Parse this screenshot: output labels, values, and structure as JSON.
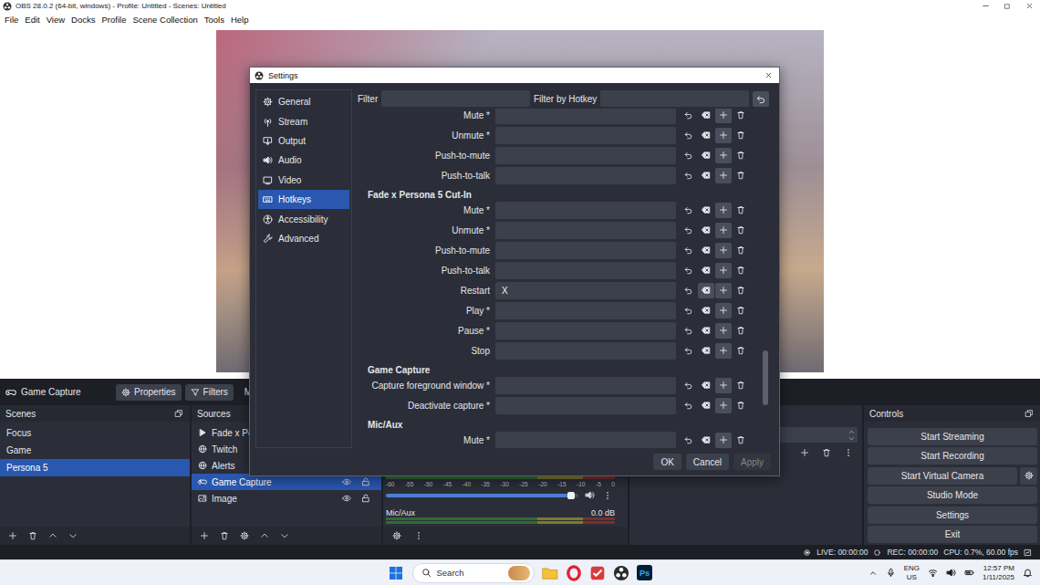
{
  "window": {
    "title": "OBS 28.0.2 (64-bit, windows) - Profile: Untitled - Scenes: Untitled"
  },
  "menu": [
    "File",
    "Edit",
    "View",
    "Docks",
    "Profile",
    "Scene Collection",
    "Tools",
    "Help"
  ],
  "source_toolbar": {
    "source": "Game Capture",
    "properties": "Properties",
    "filters": "Filters",
    "mode": "Mode"
  },
  "scenes": {
    "title": "Scenes",
    "items": [
      {
        "label": "Focus",
        "selected": false
      },
      {
        "label": "Game",
        "selected": false
      },
      {
        "label": "Persona 5",
        "selected": true
      }
    ]
  },
  "sources": {
    "title": "Sources",
    "items": [
      {
        "label": "Fade x Perso",
        "kind": "media",
        "selected": false,
        "visible": true,
        "locked": false
      },
      {
        "label": "Twitch",
        "kind": "browser",
        "selected": false,
        "visible": true,
        "locked": false
      },
      {
        "label": "Alerts",
        "kind": "browser",
        "selected": false,
        "visible": true,
        "locked": false
      },
      {
        "label": "Game Capture",
        "kind": "game",
        "selected": true,
        "visible": true,
        "locked": false
      },
      {
        "label": "Image",
        "kind": "image",
        "selected": false,
        "visible": true,
        "locked": false
      }
    ]
  },
  "mixer": {
    "scale": [
      "-60",
      "-55",
      "-50",
      "-45",
      "-40",
      "-35",
      "-30",
      "-25",
      "-20",
      "-15",
      "-10",
      "-5",
      "0"
    ],
    "volume": {
      "level": 0.97,
      "muted": false
    },
    "channel": {
      "name": "Mic/Aux",
      "reading": "0.0 dB"
    }
  },
  "controls": {
    "title": "Controls",
    "buttons": [
      "Start Streaming",
      "Start Recording",
      "Start Virtual Camera",
      "Studio Mode",
      "Settings",
      "Exit"
    ]
  },
  "status_bar": {
    "live": "LIVE: 00:00:00",
    "rec": "REC: 00:00:00",
    "cpu": "CPU: 0.7%, 60.00 fps"
  },
  "settings": {
    "title": "Settings",
    "nav": [
      {
        "label": "General",
        "selected": false
      },
      {
        "label": "Stream",
        "selected": false
      },
      {
        "label": "Output",
        "selected": false
      },
      {
        "label": "Audio",
        "selected": false
      },
      {
        "label": "Video",
        "selected": false
      },
      {
        "label": "Hotkeys",
        "selected": true
      },
      {
        "label": "Accessibility",
        "selected": false
      },
      {
        "label": "Advanced",
        "selected": false
      }
    ],
    "filter_label": "Filter",
    "hotkey_filter_label": "Filter by Hotkey",
    "scrollbar": {
      "level": 0.85
    },
    "entries": [
      {
        "kind": "hotkey",
        "label": "Mute *",
        "value": ""
      },
      {
        "kind": "hotkey",
        "label": "Unmute *",
        "value": ""
      },
      {
        "kind": "hotkey",
        "label": "Push-to-mute",
        "value": ""
      },
      {
        "kind": "hotkey",
        "label": "Push-to-talk",
        "value": ""
      },
      {
        "kind": "header",
        "label": "Fade x Persona 5 Cut-In"
      },
      {
        "kind": "hotkey",
        "label": "Mute *",
        "value": ""
      },
      {
        "kind": "hotkey",
        "label": "Unmute *",
        "value": ""
      },
      {
        "kind": "hotkey",
        "label": "Push-to-mute",
        "value": ""
      },
      {
        "kind": "hotkey",
        "label": "Push-to-talk",
        "value": ""
      },
      {
        "kind": "hotkey",
        "label": "Restart",
        "value": "X"
      },
      {
        "kind": "hotkey",
        "label": "Play *",
        "value": ""
      },
      {
        "kind": "hotkey",
        "label": "Pause *",
        "value": ""
      },
      {
        "kind": "hotkey",
        "label": "Stop",
        "value": ""
      },
      {
        "kind": "header",
        "label": "Game Capture"
      },
      {
        "kind": "hotkey",
        "label": "Capture foreground window *",
        "value": ""
      },
      {
        "kind": "hotkey",
        "label": "Deactivate capture *",
        "value": ""
      },
      {
        "kind": "header",
        "label": "Mic/Aux"
      },
      {
        "kind": "hotkey",
        "label": "Mute *",
        "value": ""
      }
    ],
    "buttons": [
      {
        "label": "OK",
        "disabled": false
      },
      {
        "label": "Cancel",
        "disabled": false
      },
      {
        "label": "Apply",
        "disabled": true
      }
    ]
  },
  "taskbar": {
    "search": "Search",
    "apps": [
      {
        "kind": "explorer"
      },
      {
        "kind": "opera"
      },
      {
        "kind": "todo"
      },
      {
        "kind": "obs"
      },
      {
        "kind": "photoshop",
        "label": "Ps"
      }
    ],
    "language": "ENG",
    "region": "US",
    "time": "12:57 PM",
    "date": "1/11/2025"
  }
}
